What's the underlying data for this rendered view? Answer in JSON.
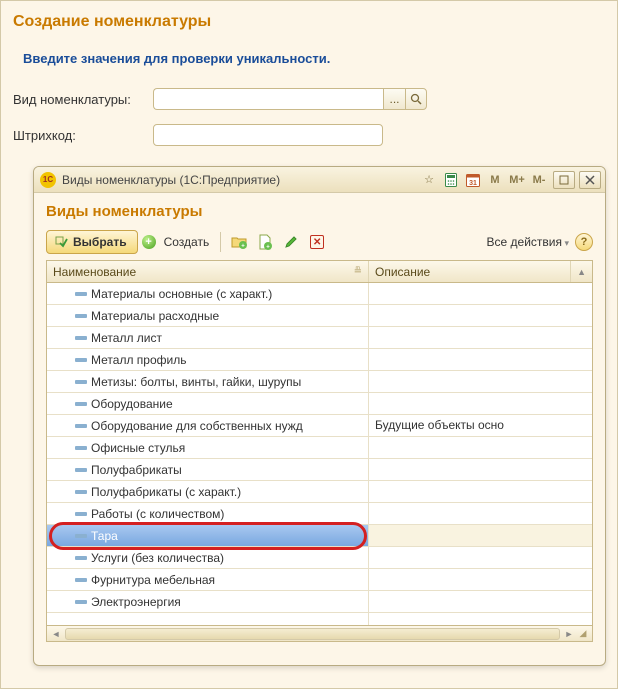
{
  "page": {
    "title": "Создание номенклатуры",
    "instruction": "Введите значения для проверки уникальности."
  },
  "form": {
    "nomenclature_label": "Вид номенклатуры:",
    "nomenclature_value": "",
    "barcode_label": "Штрихкод:",
    "barcode_value": "",
    "ellipsis": "..."
  },
  "dialog": {
    "titlebar": {
      "logo": "1C",
      "title": "Виды номенклатуры  (1С:Предприятие)",
      "m": "M",
      "mplus": "M+",
      "mminus": "M-"
    },
    "title": "Виды номенклатуры",
    "toolbar": {
      "select": "Выбрать",
      "create": "Создать",
      "all_actions": "Все действия",
      "help": "?"
    },
    "columns": {
      "name": "Наименование",
      "desc": "Описание"
    },
    "rows": [
      {
        "name": "Материалы основные (с характ.)",
        "desc": "",
        "selected": false
      },
      {
        "name": "Материалы расходные",
        "desc": "",
        "selected": false
      },
      {
        "name": "Металл лист",
        "desc": "",
        "selected": false
      },
      {
        "name": "Металл профиль",
        "desc": "",
        "selected": false
      },
      {
        "name": "Метизы: болты, винты, гайки, шурупы",
        "desc": "",
        "selected": false
      },
      {
        "name": "Оборудование",
        "desc": "",
        "selected": false
      },
      {
        "name": "Оборудование для собственных нужд",
        "desc": "Будущие объекты осно",
        "selected": false
      },
      {
        "name": "Офисные стулья",
        "desc": "",
        "selected": false
      },
      {
        "name": "Полуфабрикаты",
        "desc": "",
        "selected": false
      },
      {
        "name": "Полуфабрикаты (с характ.)",
        "desc": "",
        "selected": false
      },
      {
        "name": "Работы (с количеством)",
        "desc": "",
        "selected": false
      },
      {
        "name": "Тара",
        "desc": "",
        "selected": true
      },
      {
        "name": "Услуги (без количества)",
        "desc": "",
        "selected": false
      },
      {
        "name": "Фурнитура мебельная",
        "desc": "",
        "selected": false
      },
      {
        "name": "Электроэнергия",
        "desc": "",
        "selected": false
      }
    ]
  }
}
